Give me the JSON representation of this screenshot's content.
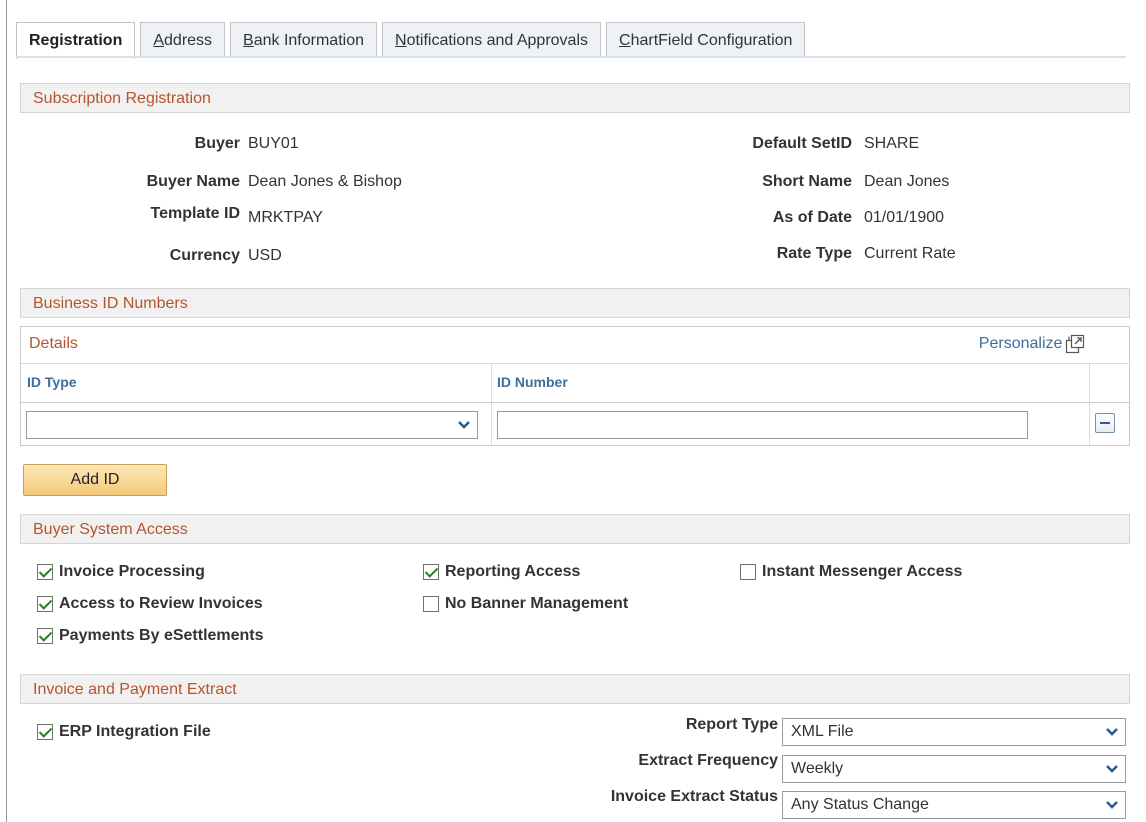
{
  "tabs": [
    {
      "label": "Registration",
      "ul": "",
      "rest": "Registration"
    },
    {
      "label": "Address",
      "ul": "A",
      "rest": "ddress"
    },
    {
      "label": "Bank Information",
      "ul": "B",
      "rest": "ank Information"
    },
    {
      "label": "Notifications and Approvals",
      "ul": "N",
      "rest": "otifications and Approvals"
    },
    {
      "label": "ChartField Configuration",
      "ul": "C",
      "rest": "hartField Configuration"
    }
  ],
  "subscription": {
    "title": "Subscription Registration",
    "buyer_label": "Buyer",
    "buyer_value": "BUY01",
    "buyer_name_label": "Buyer Name",
    "buyer_name_value": "Dean Jones & Bishop",
    "template_label": "Template ID",
    "template_value": "MRKTPAY",
    "currency_label": "Currency",
    "currency_value": "USD",
    "setid_label": "Default SetID",
    "setid_value": "SHARE",
    "short_name_label": "Short Name",
    "short_name_value": "Dean Jones",
    "asof_label": "As of Date",
    "asof_value": "01/01/1900",
    "rate_label": "Rate Type",
    "rate_value": "Current Rate"
  },
  "business_ids": {
    "title": "Business ID Numbers",
    "grid_title": "Details",
    "personalize": "Personalize |",
    "col_id_type": "ID Type",
    "col_id_number": "ID Number",
    "row_id_type": "",
    "row_id_number": "",
    "add_button": "Add ID"
  },
  "access": {
    "title": "Buyer System Access",
    "invoice_processing": "Invoice Processing",
    "review_invoices": "Access to Review Invoices",
    "payments": "Payments By eSettlements",
    "reporting": "Reporting Access",
    "no_banner": "No Banner Management",
    "instant_messenger": "Instant Messenger Access"
  },
  "extract": {
    "title": "Invoice and Payment Extract",
    "erp": "ERP Integration File",
    "report_type_label": "Report Type",
    "report_type_value": "XML File",
    "frequency_label": "Extract Frequency",
    "frequency_value": "Weekly",
    "status_label": "Invoice Extract Status",
    "status_value": "Any Status Change"
  },
  "colors": {
    "section_text": "#b6552b",
    "link": "#3d6f9b"
  }
}
